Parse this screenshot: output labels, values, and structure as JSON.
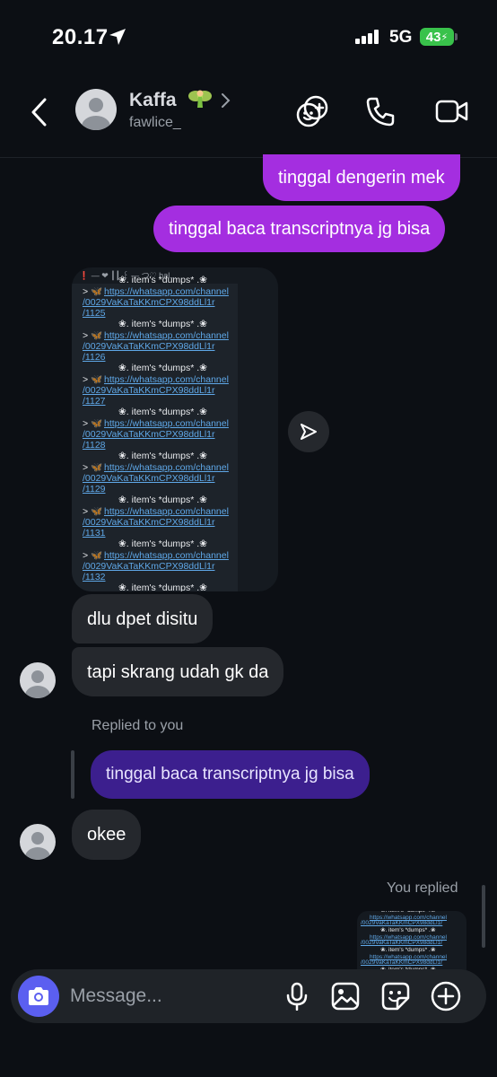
{
  "status": {
    "time": "20.17",
    "network": "5G",
    "battery": "43"
  },
  "header": {
    "name": "Kaffa",
    "username": "fawlice_"
  },
  "messages": {
    "out1": "tinggal dengerin mek",
    "out2": "tinggal baca transcriptnya jg bisa",
    "in1": "dlu dpet disitu",
    "in2": "tapi skrang udah gk da",
    "replied_label": "Replied to you",
    "reply_quote": "tinggal baca transcriptnya jg bisa",
    "in3": "okee",
    "you_replied": "You replied"
  },
  "shared_image": {
    "top_text": "❗ — ❤  ┃┃ ꒰  — つ♡ hal...",
    "title": "❀.  item's *dumps* .❀",
    "prefix": "> 🦋",
    "link_line1": "https://whatsapp.com/channel",
    "link_line2": "/0029VaKaTaKKmCPX98ddLl1r",
    "entries": [
      "/1125",
      "/1126",
      "/1127",
      "/1128",
      "/1129",
      "/1131",
      "/1132"
    ]
  },
  "composer": {
    "placeholder": "Message..."
  },
  "colors": {
    "outgoing": "#a42ee0",
    "incoming": "#25282d",
    "reply": "#3c1f8e",
    "accent": "#5b5ff0",
    "battery": "#39c24b"
  }
}
